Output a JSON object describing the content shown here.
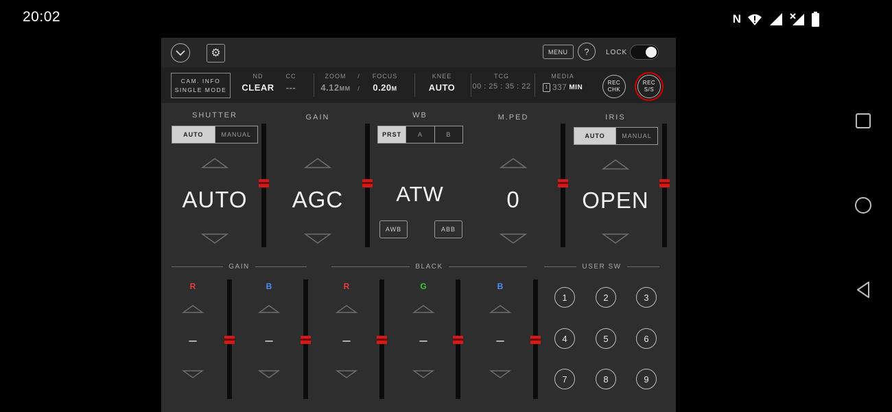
{
  "status_bar": {
    "time": "20:02"
  },
  "top_bar": {
    "menu_label": "MENU",
    "help_label": "?",
    "lock_label": "LOCK",
    "lock_on": true
  },
  "info_bar": {
    "cam_info": {
      "line1": "CAM. INFO",
      "line2": "SINGLE MODE"
    },
    "nd": {
      "label": "ND",
      "value": "CLEAR"
    },
    "cc": {
      "label": "CC",
      "value": "---"
    },
    "zoom_focus": {
      "zoom_label": "ZOOM",
      "separator": "/",
      "focus_label": "FOCUS",
      "zoom_value": "4.12",
      "zoom_unit": "MM",
      "focus_value": "0.20",
      "focus_unit": "M"
    },
    "knee": {
      "label": "KNEE",
      "value": "AUTO"
    },
    "tcg": {
      "label": "TCG",
      "value": "00 : 25 : 35 : 22"
    },
    "media": {
      "label": "MEDIA",
      "slot": "1",
      "value": "337",
      "unit": "MIN"
    },
    "rec_chk": {
      "line1": "REC",
      "line2": "CHK"
    },
    "rec_ss": {
      "line1": "REC",
      "line2": "S/S"
    }
  },
  "controls": {
    "shutter": {
      "label": "SHUTTER",
      "mode_auto": "AUTO",
      "mode_manual": "MANUAL",
      "selected_mode": "AUTO",
      "value": "AUTO"
    },
    "gain": {
      "label": "GAIN",
      "value": "AGC"
    },
    "wb": {
      "label": "WB",
      "mode_prst": "PRST",
      "mode_a": "A",
      "mode_b": "B",
      "selected_mode": "PRST",
      "value": "ATW",
      "awb": "AWB",
      "abb": "ABB"
    },
    "mped": {
      "label": "M.PED",
      "value": "0"
    },
    "iris": {
      "label": "IRIS",
      "mode_auto": "AUTO",
      "mode_manual": "MANUAL",
      "selected_mode": "AUTO",
      "value": "OPEN"
    }
  },
  "lower": {
    "gain_group": {
      "label": "GAIN",
      "channels": [
        {
          "label": "R",
          "value": "–",
          "color": "#e23c3c"
        },
        {
          "label": "B",
          "value": "–",
          "color": "#4f8df5"
        }
      ]
    },
    "black_group": {
      "label": "BLACK",
      "channels": [
        {
          "label": "R",
          "value": "–",
          "color": "#e23c3c"
        },
        {
          "label": "G",
          "value": "–",
          "color": "#3ac53a"
        },
        {
          "label": "B",
          "value": "–",
          "color": "#4f8df5"
        }
      ]
    },
    "user_sw": {
      "label": "USER SW",
      "buttons": [
        "1",
        "2",
        "3",
        "4",
        "5",
        "6",
        "7",
        "8",
        "9"
      ]
    }
  },
  "colors": {
    "app_bg": "#2e2e2e",
    "bar_bg": "#212121",
    "slider_handle": "#d51818",
    "rec_ring": "#d40000",
    "seg_selected_bg": "#cfcfcf"
  }
}
